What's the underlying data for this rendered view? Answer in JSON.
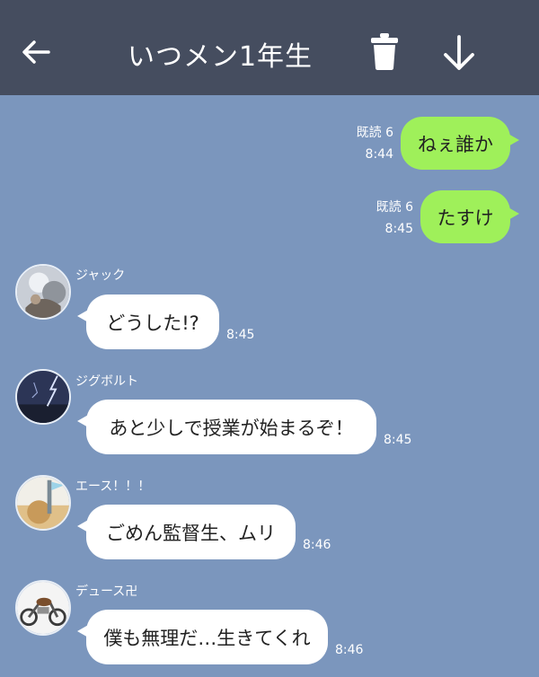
{
  "header": {
    "title": "いつメン1年生",
    "back_icon": "arrow-left-icon",
    "trash_icon": "trash-icon",
    "download_icon": "arrow-down-icon",
    "background": "#454d5f"
  },
  "colors": {
    "chat_background": "#7b96bd",
    "outgoing_bubble": "#9ff05a",
    "incoming_bubble": "#ffffff"
  },
  "outgoing": [
    {
      "text": "ねぇ誰か",
      "read": "既読 6",
      "time": "8:44"
    },
    {
      "text": "たすけ",
      "read": "既読 6",
      "time": "8:45"
    }
  ],
  "incoming": [
    {
      "sender": "ジャック",
      "text": "どうした!?",
      "time": "8:45"
    },
    {
      "sender": "ジグボルト",
      "text": "あと少しで授業が始まるぞ！",
      "time": "8:45"
    },
    {
      "sender": "エース！！！",
      "text": "ごめん監督生、ムリ",
      "time": "8:46"
    },
    {
      "sender": "デュース卍",
      "text": "僕も無理だ…生きてくれ",
      "time": "8:46"
    }
  ]
}
